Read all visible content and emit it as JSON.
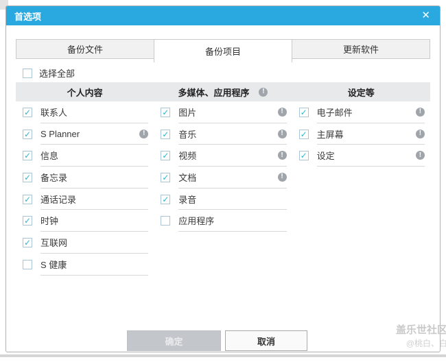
{
  "dialog": {
    "title": "首选项",
    "close_glyph": "✕"
  },
  "tabs": [
    {
      "id": "backup-files",
      "label": "备份文件",
      "active": false
    },
    {
      "id": "backup-items",
      "label": "备份项目",
      "active": true
    },
    {
      "id": "update-software",
      "label": "更新软件",
      "active": false
    }
  ],
  "select_all": {
    "label": "选择全部",
    "checked": false
  },
  "check_glyph": "✓",
  "info_glyph": "!",
  "columns": [
    {
      "id": "personal-content",
      "header": "个人内容",
      "header_info": false,
      "items": [
        {
          "label": "联系人",
          "checked": true,
          "info": false
        },
        {
          "label": "S Planner",
          "checked": true,
          "info": true
        },
        {
          "label": "信息",
          "checked": true,
          "info": false
        },
        {
          "label": "备忘录",
          "checked": true,
          "info": false
        },
        {
          "label": "通话记录",
          "checked": true,
          "info": false
        },
        {
          "label": "时钟",
          "checked": true,
          "info": false
        },
        {
          "label": "互联网",
          "checked": true,
          "info": false
        },
        {
          "label": "S 健康",
          "checked": false,
          "info": false
        }
      ]
    },
    {
      "id": "multimedia-apps",
      "header": "多媒体、应用程序",
      "header_info": true,
      "items": [
        {
          "label": "图片",
          "checked": true,
          "info": true
        },
        {
          "label": "音乐",
          "checked": true,
          "info": true
        },
        {
          "label": "视频",
          "checked": true,
          "info": true
        },
        {
          "label": "文档",
          "checked": true,
          "info": true
        },
        {
          "label": "录音",
          "checked": true,
          "info": false
        },
        {
          "label": "应用程序",
          "checked": false,
          "info": false
        }
      ]
    },
    {
      "id": "settings-etc",
      "header": "设定等",
      "header_info": false,
      "items": [
        {
          "label": "电子邮件",
          "checked": true,
          "info": true
        },
        {
          "label": "主屏幕",
          "checked": true,
          "info": true
        },
        {
          "label": "设定",
          "checked": true,
          "info": true
        }
      ]
    }
  ],
  "buttons": {
    "ok": "确定",
    "ok_disabled": true,
    "cancel": "取消"
  },
  "watermark": {
    "line1": "盖乐世社区",
    "line2": "@桃白、白"
  },
  "colors": {
    "titlebar": "#29a9e0",
    "check": "#2db6ce",
    "header_bg": "#e8e9eb"
  }
}
